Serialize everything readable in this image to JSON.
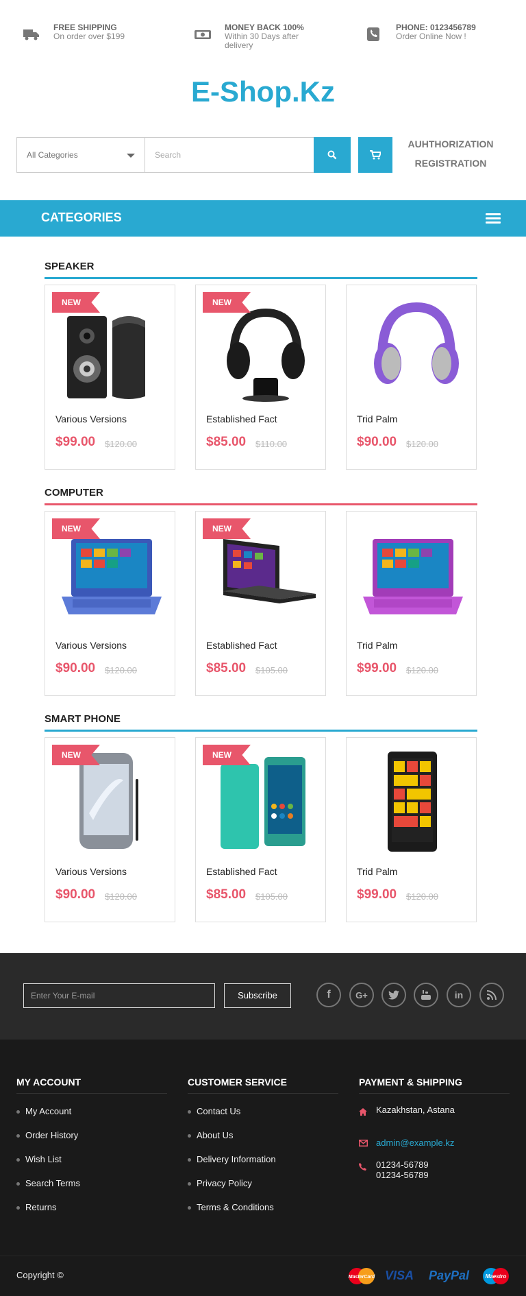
{
  "topbar": {
    "shipping_title": "FREE SHIPPING",
    "shipping_sub": "On order over $199",
    "money_title": "MONEY BACK 100%",
    "money_sub1": "Within 30 Days after",
    "money_sub2": "delivery",
    "phone_title": "PHONE: 0123456789",
    "phone_sub": "Order Online Now !"
  },
  "logo": "E-Shop.Kz",
  "search": {
    "category": "All Categories",
    "placeholder": "Search"
  },
  "auth": {
    "login": "AUHTHORIZATION",
    "register": "REGISTRATION"
  },
  "categories_label": "CATEGORIES",
  "colors": {
    "accent": "#29a9d1",
    "sale": "#e8566b",
    "footer": "#1a1a1a"
  },
  "sections": [
    {
      "title": "SPEAKER",
      "products": [
        {
          "badge": "NEW",
          "name": "Various Versions",
          "price": "$99.00",
          "old_price": "$120.00",
          "image": "speaker"
        },
        {
          "badge": "NEW",
          "name": "Established Fact",
          "price": "$85.00",
          "old_price": "$110.00",
          "image": "headphones-black"
        },
        {
          "badge": "",
          "name": "Trid Palm",
          "price": "$90.00",
          "old_price": "$120.00",
          "image": "headphones-purple"
        }
      ]
    },
    {
      "title": "COMPUTER",
      "products": [
        {
          "badge": "NEW",
          "name": "Various Versions",
          "price": "$90.00",
          "old_price": "$120.00",
          "image": "laptop-blue"
        },
        {
          "badge": "NEW",
          "name": "Established Fact",
          "price": "$85.00",
          "old_price": "$105.00",
          "image": "laptop-black"
        },
        {
          "badge": "",
          "name": "Trid Palm",
          "price": "$99.00",
          "old_price": "$120.00",
          "image": "laptop-purple"
        }
      ]
    },
    {
      "title": "SMART PHONE",
      "products": [
        {
          "badge": "NEW",
          "name": "Various Versions",
          "price": "$90.00",
          "old_price": "$120.00",
          "image": "phone-grey"
        },
        {
          "badge": "NEW",
          "name": "Established Fact",
          "price": "$85.00",
          "old_price": "$105.00",
          "image": "phone-teal"
        },
        {
          "badge": "",
          "name": "Trid Palm",
          "price": "$99.00",
          "old_price": "$120.00",
          "image": "phone-black"
        }
      ]
    }
  ],
  "newsletter": {
    "placeholder": "Enter Your E-mail",
    "button": "Subscribe"
  },
  "social_icons": [
    "facebook-icon",
    "google-plus-icon",
    "twitter-icon",
    "youtube-icon",
    "linkedin-icon",
    "rss-icon"
  ],
  "footer": {
    "my_account": {
      "title": "MY ACCOUNT",
      "items": [
        "My Account",
        "Order History",
        "Wish List",
        "Search Terms",
        "Returns"
      ]
    },
    "customer_service": {
      "title": "CUSTOMER SERVICE",
      "items": [
        "Contact Us",
        "About Us",
        "Delivery Information",
        "Privacy Policy",
        "Terms & Conditions"
      ]
    },
    "payment": {
      "title": "PAYMENT & SHIPPING",
      "address": "Kazakhstan, Astana",
      "email": "admin@example.kz",
      "phone1": "01234-56789",
      "phone2": "01234-56789"
    },
    "copyright": "Copyright ©",
    "payment_logos": [
      "MasterCard",
      "VISA",
      "PayPal",
      "Maestro"
    ]
  }
}
